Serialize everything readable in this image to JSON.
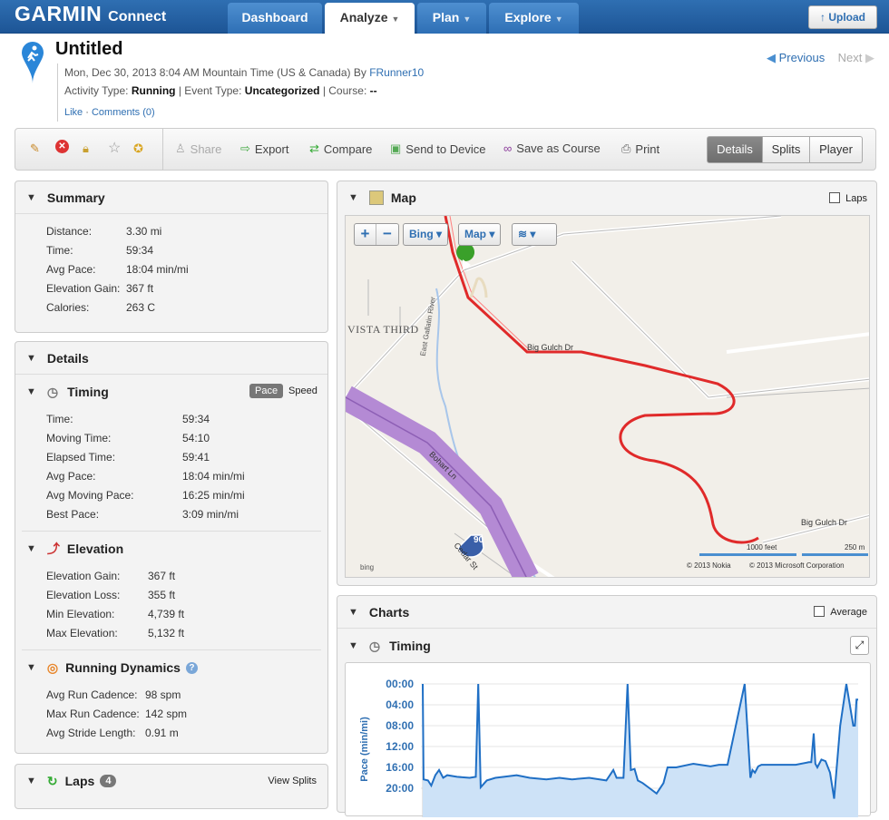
{
  "header": {
    "logo": "GARMIN",
    "logo_sub": "Connect",
    "tabs": [
      {
        "label": "Dashboard"
      },
      {
        "label": "Analyze"
      },
      {
        "label": "Plan"
      },
      {
        "label": "Explore"
      }
    ],
    "upload": "Upload"
  },
  "activity": {
    "title": "Untitled",
    "date": "Mon, Dec 30, 2013 8:04 AM Mountain Time (US & Canada) By",
    "user": "FRunner10",
    "activity_type_label": "Activity Type:",
    "activity_type": "Running",
    "event_type_label": "| Event Type:",
    "event_type": "Uncategorized",
    "course_label": "| Course:",
    "course": "--",
    "like": "Like",
    "comments": "Comments (0)",
    "previous": "Previous",
    "next": "Next"
  },
  "toolbar": {
    "share": "Share",
    "export": "Export",
    "compare": "Compare",
    "send": "Send to Device",
    "save_course": "Save as Course",
    "print": "Print",
    "details": "Details",
    "splits": "Splits",
    "player": "Player"
  },
  "summary": {
    "title": "Summary",
    "rows": [
      {
        "k": "Distance:",
        "v": "3.30 mi"
      },
      {
        "k": "Time:",
        "v": "59:34"
      },
      {
        "k": "Avg Pace:",
        "v": "18:04 min/mi"
      },
      {
        "k": "Elevation Gain:",
        "v": "367 ft"
      },
      {
        "k": "Calories:",
        "v": "263 C"
      }
    ]
  },
  "details": {
    "title": "Details",
    "timing": {
      "title": "Timing",
      "pace": "Pace",
      "speed": "Speed",
      "rows": [
        {
          "k": "Time:",
          "v": "59:34"
        },
        {
          "k": "Moving Time:",
          "v": "54:10"
        },
        {
          "k": "Elapsed Time:",
          "v": "59:41"
        },
        {
          "k": "Avg Pace:",
          "v": "18:04 min/mi"
        },
        {
          "k": "Avg Moving Pace:",
          "v": "16:25 min/mi"
        },
        {
          "k": "Best Pace:",
          "v": "3:09 min/mi"
        }
      ]
    },
    "elevation": {
      "title": "Elevation",
      "rows": [
        {
          "k": "Elevation Gain:",
          "v": "367 ft"
        },
        {
          "k": "Elevation Loss:",
          "v": "355 ft"
        },
        {
          "k": "Min Elevation:",
          "v": "4,739 ft"
        },
        {
          "k": "Max Elevation:",
          "v": "5,132 ft"
        }
      ]
    },
    "dynamics": {
      "title": "Running Dynamics",
      "rows": [
        {
          "k": "Avg Run Cadence:",
          "v": "98 spm"
        },
        {
          "k": "Max Run Cadence:",
          "v": "142 spm"
        },
        {
          "k": "Avg Stride Length:",
          "v": "0.91 m"
        }
      ]
    }
  },
  "laps": {
    "title": "Laps",
    "count": "4",
    "view": "View Splits"
  },
  "map": {
    "title": "Map",
    "laps": "Laps",
    "bing": "Bing",
    "map": "Map",
    "labels": {
      "vista": "VISTA THIRD",
      "biggulch1": "Big Gulch Dr",
      "biggulch2": "Big Gulch Dr",
      "river": "East Gallatin River",
      "bohart": "Bohart Ln",
      "cedar": "Cedar St",
      "i90": "90",
      "scale_ft": "1000 feet",
      "scale_m": "250 m",
      "nokia": "© 2013 Nokia",
      "ms": "© 2013 Microsoft Corporation",
      "bing_logo": "bing"
    }
  },
  "charts": {
    "title": "Charts",
    "average": "Average",
    "timing": "Timing"
  },
  "chart_data": {
    "type": "area",
    "ylabel": "Pace (min/mi)",
    "yticks": [
      "00:00",
      "04:00",
      "08:00",
      "12:00",
      "16:00",
      "20:00"
    ],
    "ylim": [
      0,
      22
    ],
    "y_inverted": true,
    "grid": true,
    "x": [
      0,
      0.2,
      1.3,
      2.1,
      3.1,
      4,
      5,
      6,
      8.4,
      11.5,
      13,
      13.6,
      14.2,
      15.7,
      17.8,
      19.9,
      23,
      26.2,
      30.3,
      33.5,
      36.6,
      40.8,
      45,
      46.7,
      47.5,
      49.2,
      50.2,
      51,
      51.9,
      52.7,
      53.9,
      55.6,
      57.3,
      59,
      60,
      62.1,
      66.3,
      70.5,
      72.6,
      74.7,
      78.9,
      80.3,
      80.8,
      81.4,
      82.2,
      83,
      83.7,
      87.2,
      91.4,
      94.6,
      95.2,
      95.8,
      96.2,
      96.7,
      97.7,
      98.7,
      99.8,
      100.8,
      102.3,
      103.8,
      105.5,
      105.9,
      106.3,
      106.7
    ],
    "values": [
      0,
      18.3,
      18.5,
      19.5,
      17.5,
      16.5,
      18,
      17.5,
      17.8,
      18,
      17.8,
      0,
      19.8,
      18.5,
      18,
      17.8,
      17.5,
      18,
      18.3,
      18,
      18.3,
      18,
      18.5,
      16.5,
      18,
      18,
      0,
      16.5,
      16.3,
      18.5,
      19,
      20,
      21,
      19,
      16,
      16,
      15.3,
      15.8,
      15.5,
      15.5,
      0,
      18,
      16.5,
      17,
      15.8,
      15.5,
      15.5,
      15.5,
      15.5,
      15,
      15,
      9.5,
      15.3,
      16,
      14.5,
      14.8,
      17,
      22,
      8,
      0,
      8,
      8,
      3,
      3
    ]
  }
}
